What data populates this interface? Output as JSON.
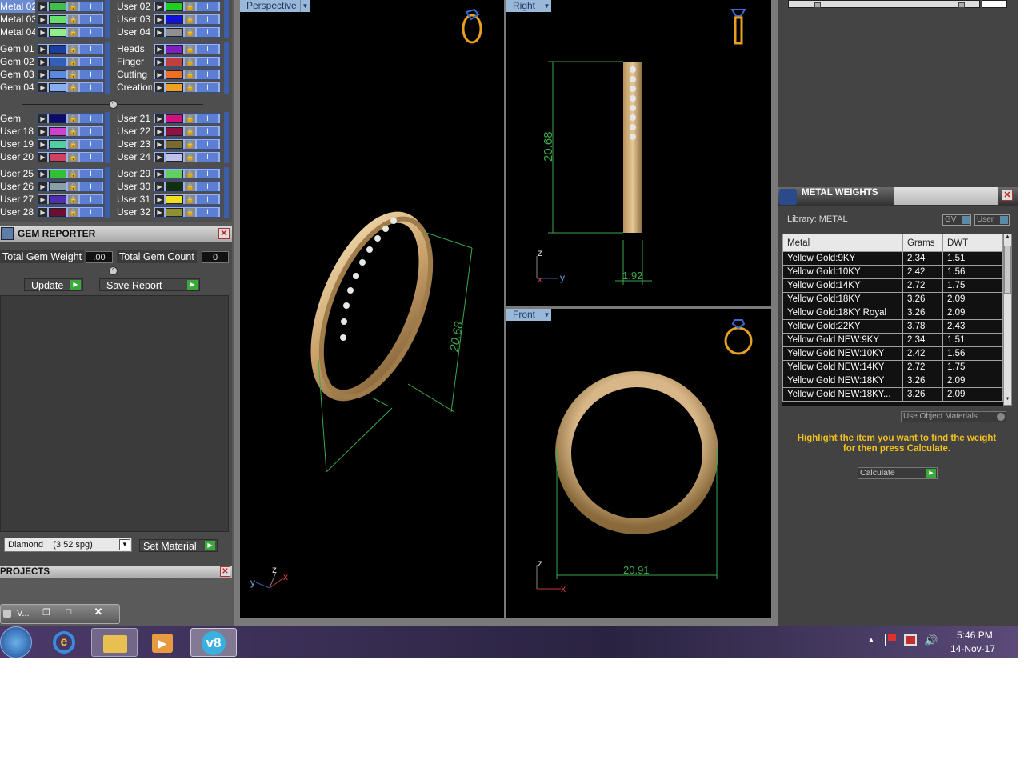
{
  "layers": {
    "left": [
      {
        "name": "Metal 02",
        "color": "#3fbf4a",
        "selected": true
      },
      {
        "name": "Metal 03",
        "color": "#66e06a"
      },
      {
        "name": "Metal 04",
        "color": "#8ff08a"
      },
      {
        "name": "Gem 01",
        "color": "#1a3fa0"
      },
      {
        "name": "Gem 02",
        "color": "#3060b8"
      },
      {
        "name": "Gem 03",
        "color": "#5a8ae0"
      },
      {
        "name": "Gem 04",
        "color": "#86aef0"
      },
      {
        "name": "Gem",
        "color": "#0a0a70"
      },
      {
        "name": "User 18",
        "color": "#d040d0"
      },
      {
        "name": "User 19",
        "color": "#50d0a0"
      },
      {
        "name": "User 20",
        "color": "#d04060"
      },
      {
        "name": "User 25",
        "color": "#30c030"
      },
      {
        "name": "User 26",
        "color": "#8aa0a8"
      },
      {
        "name": "User 27",
        "color": "#5030b0"
      },
      {
        "name": "User 28",
        "color": "#6a1030"
      }
    ],
    "right": [
      {
        "name": "User 02",
        "color": "#20d020"
      },
      {
        "name": "User 03",
        "color": "#1010e0"
      },
      {
        "name": "User 04",
        "color": "#909090"
      },
      {
        "name": "Heads",
        "color": "#8020c0"
      },
      {
        "name": "Finger",
        "color": "#c04040"
      },
      {
        "name": "Cutting",
        "color": "#f07020"
      },
      {
        "name": "Creation",
        "color": "#f0a020"
      },
      {
        "name": "User 21",
        "color": "#d01080"
      },
      {
        "name": "User 22",
        "color": "#901040"
      },
      {
        "name": "User 23",
        "color": "#7a6a30"
      },
      {
        "name": "User 24",
        "color": "#c0c0f0"
      },
      {
        "name": "User 29",
        "color": "#60d060"
      },
      {
        "name": "User 30",
        "color": "#103010"
      },
      {
        "name": "User 31",
        "color": "#f0e020"
      },
      {
        "name": "User 32",
        "color": "#909030"
      }
    ]
  },
  "gem_reporter": {
    "title": "GEM REPORTER",
    "total_weight_label": "Total Gem Weight",
    "total_weight_value": ".00",
    "total_count_label": "Total Gem Count",
    "total_count_value": "0",
    "update_label": "Update",
    "save_label": "Save Report",
    "material_select": "Diamond    (3.52 spg)",
    "set_material_label": "Set Material"
  },
  "projects": {
    "title": "PROJECTS",
    "mini_window_label": "V..."
  },
  "viewports": {
    "perspective": {
      "label": "Perspective",
      "dimension": "20.68",
      "axes": [
        "y",
        "z",
        "x"
      ]
    },
    "right": {
      "label": "Right",
      "dim_height": "20.68",
      "dim_width": "1.92",
      "axes": [
        "z",
        "x",
        "y"
      ]
    },
    "front": {
      "label": "Front",
      "dim_width": "20.91",
      "axes": [
        "z",
        "x"
      ]
    }
  },
  "metal_weights": {
    "title": "METAL WEIGHTS",
    "library": "Library: METAL",
    "gv_label": "GV",
    "user_label": "User",
    "columns": [
      "Metal",
      "Grams",
      "DWT"
    ],
    "rows": [
      [
        "Yellow Gold:9KY",
        "2.34",
        "1.51"
      ],
      [
        "Yellow Gold:10KY",
        "2.42",
        "1.56"
      ],
      [
        "Yellow Gold:14KY",
        "2.72",
        "1.75"
      ],
      [
        "Yellow Gold:18KY",
        "3.26",
        "2.09"
      ],
      [
        "Yellow Gold:18KY Royal",
        "3.26",
        "2.09"
      ],
      [
        "Yellow Gold:22KY",
        "3.78",
        "2.43"
      ],
      [
        "Yellow Gold NEW:9KY",
        "2.34",
        "1.51"
      ],
      [
        "Yellow Gold NEW:10KY",
        "2.42",
        "1.56"
      ],
      [
        "Yellow Gold NEW:14KY",
        "2.72",
        "1.75"
      ],
      [
        "Yellow Gold NEW:18KY",
        "3.26",
        "2.09"
      ],
      [
        "Yellow Gold NEW:18KY...",
        "3.26",
        "2.09"
      ]
    ],
    "use_object_label": "Use Object Materials",
    "hint": "Highlight the item you want to find the weight for then press Calculate.",
    "calculate_label": "Calculate"
  },
  "taskbar": {
    "time": "5:46 PM",
    "date": "14-Nov-17",
    "v8_label": "v8"
  }
}
